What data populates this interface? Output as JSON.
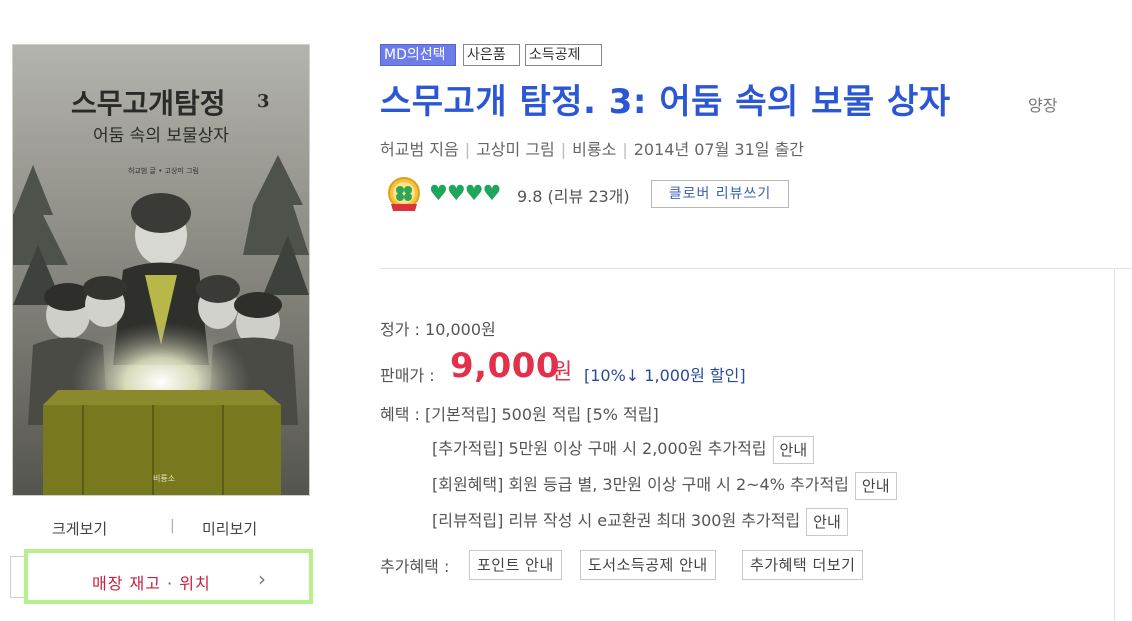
{
  "left": {
    "cover": {
      "title_line": "스무고개탐정",
      "title_number": "3",
      "subtitle": "어둠 속의 보물상자",
      "author_small": "허교범 글 • 고상미 그림",
      "publisher_small": "비룡소"
    },
    "zoom_label": "크게보기",
    "preview_label": "미리보기",
    "separator": "|",
    "store_button_label": "매장 재고 · 위치",
    "store_button_icon": "chevron-right-icon"
  },
  "badges": {
    "md_pick": "MD의선택",
    "gift": "사은품",
    "tax_deduction": "소득공제"
  },
  "product": {
    "title": "스무고개 탐정. 3: 어둠 속의 보물 상자",
    "binding": "양장",
    "author": "허교범 지음",
    "illustrator": "고상미 그림",
    "publisher": "비룡소",
    "pub_date": "2014년 07월 31일 출간"
  },
  "rating": {
    "medal_icon": "clover-medal-icon",
    "hearts": "♥♥♥♥",
    "hearts_filled": 4,
    "score": "9.8",
    "review_count": "(리뷰 23개)",
    "write_review_button": "클로버 리뷰쓰기"
  },
  "price": {
    "list_label": "정가 :",
    "list_value": "10,000원",
    "sale_label": "판매가 :",
    "sale_value": "9,000",
    "sale_unit": "원",
    "discount": "[10%↓ 1,000원 할인]"
  },
  "benefits": {
    "label": "혜택 :",
    "basic": "[기본적립] 500원 적립 [5% 적립]",
    "additional": "[추가적립] 5만원 이상 구매 시 2,000원 추가적립",
    "member": "[회원혜택] 회원 등급 별, 3만원 이상 구매 시 2~4% 추가적립",
    "review": "[리뷰적립] 리뷰 작성 시 e교환권 최대 300원 추가적립",
    "guide_button": "안내"
  },
  "extra": {
    "label": "추가혜택 :",
    "buttons": [
      "포인트 안내",
      "도서소득공제 안내",
      "추가혜택 더보기"
    ]
  },
  "colors": {
    "title_blue": "#2b57d4",
    "sale_red": "#e3314b",
    "discount_blue": "#2c4a9b",
    "heart_green": "#1fa65a",
    "md_badge": "#6d7ce8",
    "store_border_green": "#b7ef8a",
    "store_text_red": "#c2223f"
  }
}
